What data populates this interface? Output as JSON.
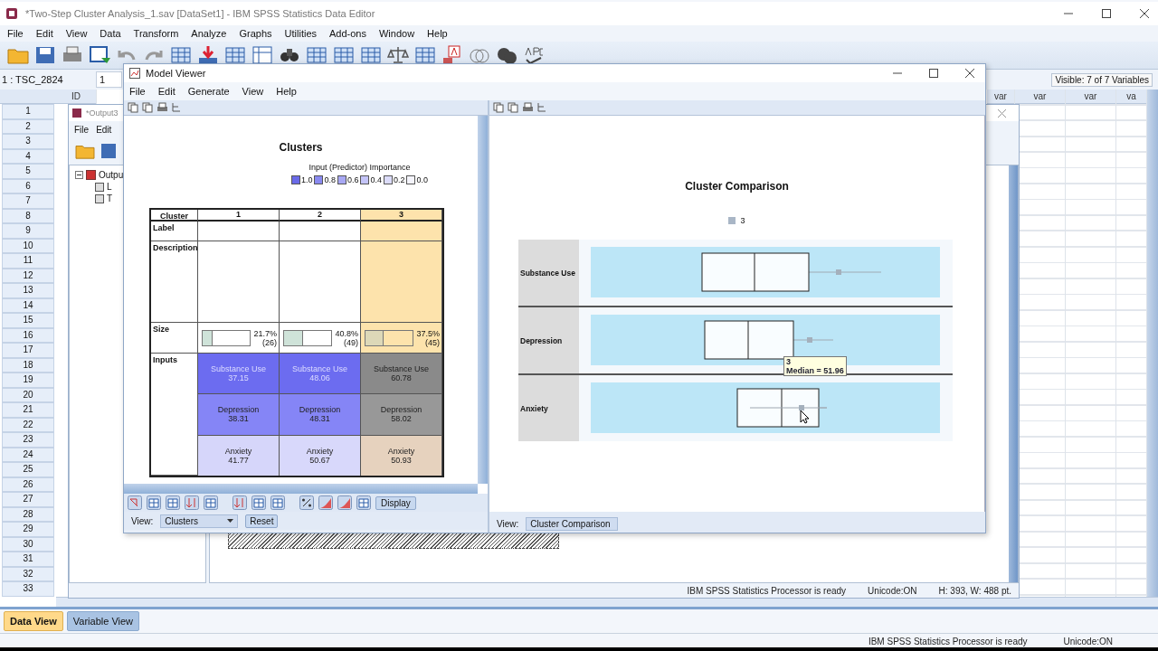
{
  "window": {
    "title": "*Two-Step Cluster Analysis_1.sav [DataSet1] - IBM SPSS Statistics Data Editor"
  },
  "menu": [
    "File",
    "Edit",
    "View",
    "Data",
    "Transform",
    "Analyze",
    "Graphs",
    "Utilities",
    "Add-ons",
    "Window",
    "Help"
  ],
  "cell_bar": {
    "cell_ref": "1 : TSC_2824",
    "cell_value": "1",
    "visible_count": "Visible: 7 of 7 Variables"
  },
  "grid": {
    "columns_left": [
      "ID"
    ],
    "columns_right": [
      "var",
      "var",
      "var",
      "va"
    ],
    "rows": [
      "1",
      "2",
      "3",
      "4",
      "5",
      "6",
      "7",
      "8",
      "9",
      "10",
      "11",
      "12",
      "13",
      "14",
      "15",
      "16",
      "17",
      "18",
      "19",
      "20",
      "21",
      "22",
      "23",
      "24",
      "25",
      "26",
      "27",
      "28",
      "29",
      "30",
      "31",
      "32",
      "33"
    ]
  },
  "view_tabs": [
    {
      "label": "Data View",
      "selected": true
    },
    {
      "label": "Variable View",
      "selected": false
    }
  ],
  "status_bar": {
    "message": "IBM SPSS Statistics Processor is ready",
    "unicode": "Unicode:ON"
  },
  "output_window": {
    "title": "*Output3",
    "menu": [
      "File",
      "Edit"
    ],
    "tree": [
      {
        "label": "Outpu",
        "children": [
          {
            "label": "L"
          },
          {
            "label": "T"
          }
        ]
      }
    ],
    "status_bar": {
      "message": "IBM SPSS Statistics Processor is ready",
      "unicode": "Unicode:ON",
      "size": "H: 393, W: 488 pt."
    }
  },
  "model_viewer": {
    "title": "Model Viewer",
    "menu": [
      "File",
      "Edit",
      "Generate",
      "View",
      "Help"
    ],
    "left": {
      "title": "Clusters",
      "importance_title": "Input (Predictor) Importance",
      "importance_legend": [
        {
          "label": "1.0",
          "color": "#6a6ae8"
        },
        {
          "label": "0.8",
          "color": "#8a8af0"
        },
        {
          "label": "0.6",
          "color": "#a8a8f4"
        },
        {
          "label": "0.4",
          "color": "#c4c4f8"
        },
        {
          "label": "0.2",
          "color": "#dcdcfa"
        },
        {
          "label": "0.0",
          "color": "#f4f4fc"
        }
      ],
      "table": {
        "header": "Cluster",
        "row_labels": [
          "Label",
          "Description",
          "Size",
          "Inputs"
        ],
        "clusters": [
          {
            "label": "1",
            "selected": false,
            "size": {
              "level": 0.217,
              "percent": "21.7%",
              "count": "(26)"
            },
            "inputs": [
              {
                "name": "Substance Use",
                "value": "37.15",
                "color": "#6c6cf0"
              },
              {
                "name": "Depression",
                "value": "38.31",
                "color": "#8585f6"
              },
              {
                "name": "Anxiety",
                "value": "41.77",
                "color": "#d6d6fa"
              }
            ]
          },
          {
            "label": "2",
            "selected": false,
            "size": {
              "level": 0.408,
              "percent": "40.8%",
              "count": "(49)"
            },
            "inputs": [
              {
                "name": "Substance Use",
                "value": "48.06",
                "color": "#6c6cf0"
              },
              {
                "name": "Depression",
                "value": "48.31",
                "color": "#8585f6"
              },
              {
                "name": "Anxiety",
                "value": "50.67",
                "color": "#d8d8fb"
              }
            ]
          },
          {
            "label": "3",
            "selected": true,
            "size": {
              "level": 0.375,
              "percent": "37.5%",
              "count": "(45)"
            },
            "inputs": [
              {
                "name": "Substance Use",
                "value": "60.78",
                "color": "#8a8a8a"
              },
              {
                "name": "Depression",
                "value": "58.02",
                "color": "#989898"
              },
              {
                "name": "Anxiety",
                "value": "50.93",
                "color": "#e6d2be"
              }
            ]
          }
        ]
      },
      "display_button": "Display",
      "view_label": "View:",
      "view_value": "Clusters",
      "reset_button": "Reset"
    },
    "right": {
      "title": "Cluster Comparison",
      "legend": [
        {
          "label": "3",
          "color": "#a9b6c6"
        }
      ],
      "features": [
        "Substance Use",
        "Depression",
        "Anxiety"
      ],
      "tooltip": {
        "line_1": "3",
        "line_2": "Median = 51.96"
      },
      "view_label": "View:",
      "view_value": "Cluster Comparison"
    }
  }
}
